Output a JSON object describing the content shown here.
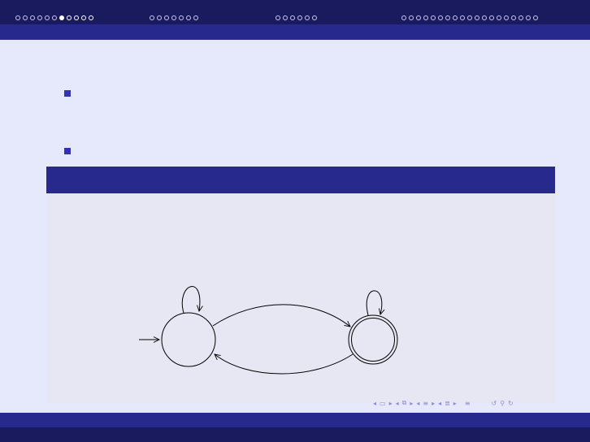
{
  "navigation": {
    "sections": [
      {
        "name": "section-1",
        "dots": 11,
        "active_index": 6
      },
      {
        "name": "section-2",
        "dots": 7,
        "active_index": -1
      },
      {
        "name": "section-3",
        "dots": 6,
        "active_index": -1
      },
      {
        "name": "section-4",
        "dots": 19,
        "active_index": -1
      }
    ]
  },
  "diagram": {
    "states": [
      {
        "id": "q0",
        "initial": true,
        "accepting": false
      },
      {
        "id": "q1",
        "initial": false,
        "accepting": true
      }
    ],
    "transitions": [
      {
        "from": "q0",
        "to": "q0"
      },
      {
        "from": "q0",
        "to": "q1"
      },
      {
        "from": "q1",
        "to": "q1"
      },
      {
        "from": "q1",
        "to": "q0"
      }
    ]
  },
  "colors": {
    "background": "#e6e8fb",
    "header_dark": "#1a1a5e",
    "header_mid": "#272a8c",
    "bullet": "#3333b2",
    "block_body": "#e6e7f3",
    "nav_symbols": "#8c8cd6"
  },
  "beamer_nav_icons": [
    "nav-prev-frame-icon",
    "frame-icon",
    "nav-next-frame-icon",
    "nav-prev-subsection-icon",
    "subsection-icon",
    "nav-next-subsection-icon",
    "nav-prev-section-icon",
    "section-icon",
    "nav-next-section-icon",
    "nav-prev-doc-icon",
    "doc-icon",
    "nav-next-doc-icon",
    "align-icon",
    "search-icon",
    "back-icon",
    "forward-icon"
  ]
}
